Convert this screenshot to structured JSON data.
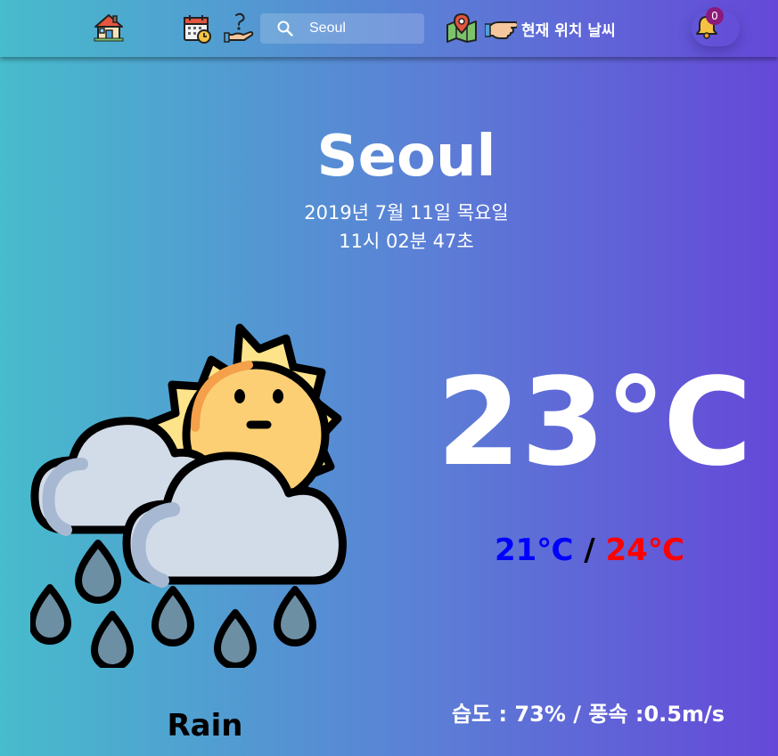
{
  "nav": {
    "home_icon": "house-icon",
    "calendar_icon": "calendar-icon",
    "help_icon": "help-hand-icon",
    "search": {
      "icon": "search-icon",
      "value": "Seoul"
    },
    "map_icon": "map-pin-icon",
    "location_button": {
      "icon": "pointing-hand-icon",
      "label": "현재 위치 날씨"
    },
    "notifications": {
      "icon": "bell-icon",
      "count": "0",
      "badge_color": "#8c1a7a"
    }
  },
  "weather": {
    "city": "Seoul",
    "date": "2019년 7월 11일 목요일",
    "time": "11시 02분 47초",
    "icon": "sun-cloud-rain-icon",
    "temperature": "23℃",
    "min_temp": "21℃",
    "separator": " / ",
    "max_temp": "24℃",
    "condition": "Rain",
    "details": "습도 : 73% / 풍속 :0.5m/s"
  },
  "colors": {
    "gradient_start": "#47bccc",
    "gradient_end": "#6548d8",
    "min_temp": "#0000ff",
    "max_temp": "#ff0000"
  }
}
